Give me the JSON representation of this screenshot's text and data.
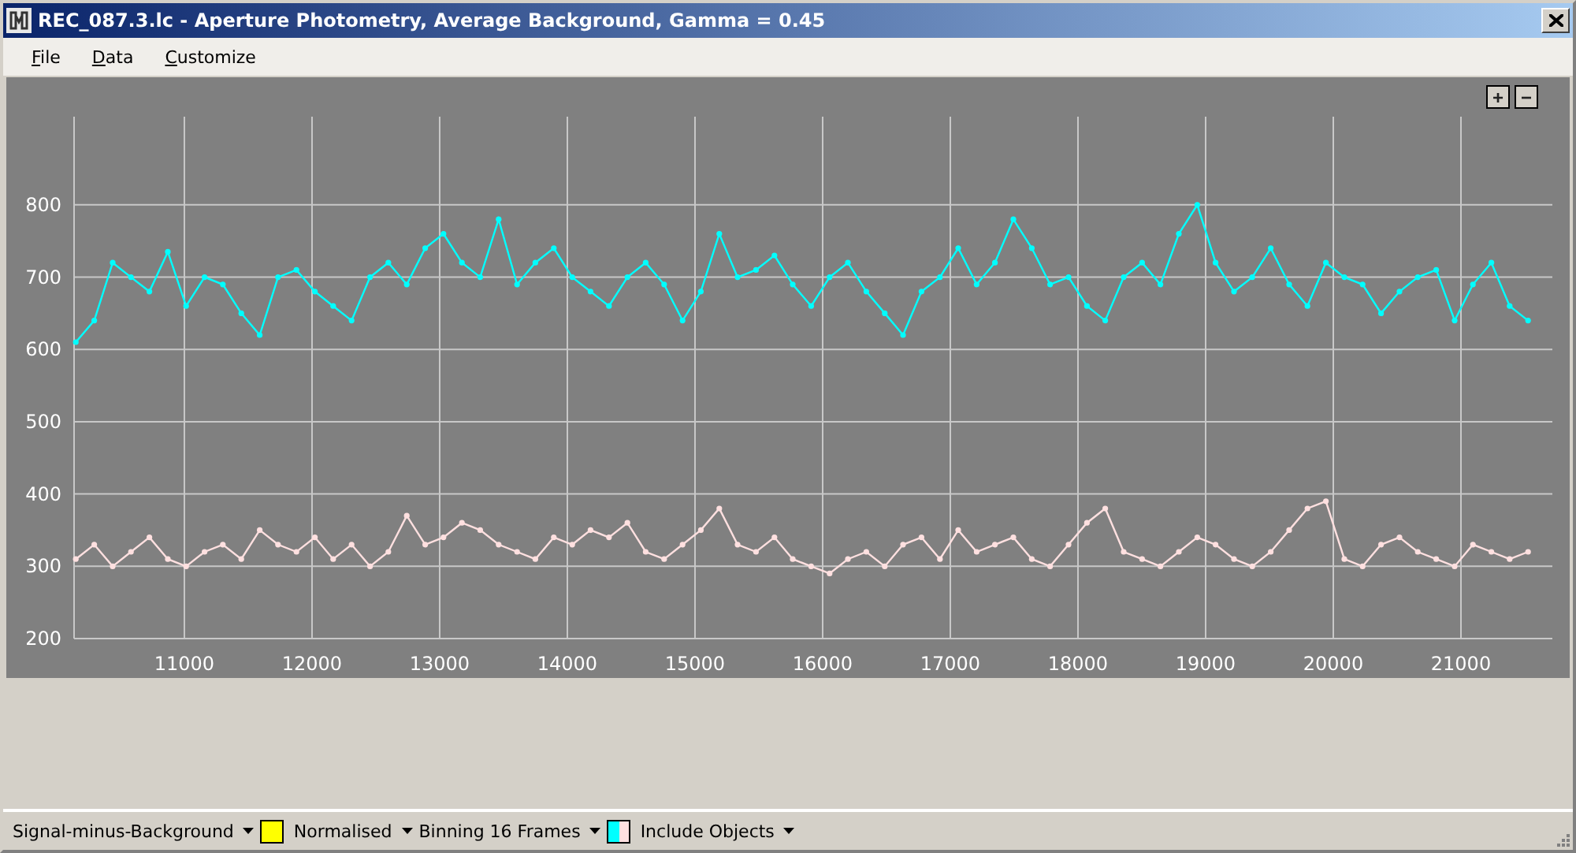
{
  "window": {
    "title": "REC_087.3.lc - Aperture Photometry, Average Background, Gamma = 0.45"
  },
  "menu": [
    {
      "label": "File"
    },
    {
      "label": "Data"
    },
    {
      "label": "Customize"
    }
  ],
  "zoom_buttons": [
    "+",
    "−"
  ],
  "chart": {
    "chart_data": {
      "type": "line",
      "grid": true,
      "xlim": [
        10136,
        21716
      ],
      "ylim": [
        200,
        922
      ],
      "xticks": [
        11000,
        12000,
        13000,
        14000,
        15000,
        16000,
        17000,
        18000,
        19000,
        20000,
        21000
      ],
      "yticks": [
        200,
        300,
        400,
        500,
        600,
        700,
        800
      ],
      "x": [
        10150,
        10294,
        10438,
        10582,
        10726,
        10870,
        11014,
        11158,
        11302,
        11446,
        11590,
        11734,
        11878,
        12022,
        12166,
        12310,
        12454,
        12598,
        12742,
        12886,
        13030,
        13174,
        13318,
        13462,
        13606,
        13750,
        13894,
        14038,
        14182,
        14326,
        14470,
        14614,
        14758,
        14902,
        15046,
        15190,
        15334,
        15478,
        15622,
        15766,
        15910,
        16054,
        16198,
        16342,
        16486,
        16630,
        16774,
        16918,
        17062,
        17206,
        17350,
        17494,
        17638,
        17782,
        17926,
        18070,
        18214,
        18358,
        18502,
        18646,
        18790,
        18934,
        19078,
        19222,
        19366,
        19510,
        19654,
        19798,
        19942,
        20086,
        20230,
        20374,
        20518,
        20662,
        20806,
        20950,
        21094,
        21238,
        21382,
        21526
      ],
      "series": [
        {
          "color": "#00ffff",
          "values": [
            610,
            640,
            720,
            700,
            680,
            735,
            660,
            700,
            690,
            650,
            620,
            700,
            710,
            680,
            660,
            640,
            700,
            720,
            690,
            740,
            760,
            720,
            700,
            780,
            690,
            720,
            740,
            700,
            680,
            660,
            700,
            720,
            690,
            640,
            680,
            760,
            700,
            710,
            730,
            690,
            660,
            700,
            720,
            680,
            650,
            620,
            680,
            700,
            740,
            690,
            720,
            780,
            740,
            690,
            700,
            660,
            640,
            700,
            720,
            690,
            760,
            800,
            720,
            680,
            700,
            740,
            690,
            660,
            720,
            700,
            690,
            650,
            680,
            700,
            710,
            640,
            690,
            720,
            660,
            640
          ]
        },
        {
          "color": "#ffe0e0",
          "values": [
            310,
            330,
            300,
            320,
            340,
            310,
            300,
            320,
            330,
            310,
            350,
            330,
            320,
            340,
            310,
            330,
            300,
            320,
            370,
            330,
            340,
            360,
            350,
            330,
            320,
            310,
            340,
            330,
            350,
            340,
            360,
            320,
            310,
            330,
            350,
            380,
            330,
            320,
            340,
            310,
            300,
            290,
            310,
            320,
            300,
            330,
            340,
            310,
            350,
            320,
            330,
            340,
            310,
            300,
            330,
            360,
            380,
            320,
            310,
            300,
            320,
            340,
            330,
            310,
            300,
            320,
            350,
            380,
            390,
            310,
            300,
            330,
            340,
            320,
            310,
            300,
            330,
            320,
            310,
            320
          ]
        }
      ]
    }
  },
  "toolbar": [
    {
      "label": "Signal-minus-Background"
    },
    {
      "label": "Normalised",
      "swatch": [
        {
          "color": "#ffff00"
        }
      ]
    },
    {
      "label": "Binning 16 Frames"
    },
    {
      "label": "Include Objects",
      "swatch": [
        {
          "color": "#00ffff"
        },
        {
          "color": "#ffe0e0"
        }
      ]
    }
  ]
}
